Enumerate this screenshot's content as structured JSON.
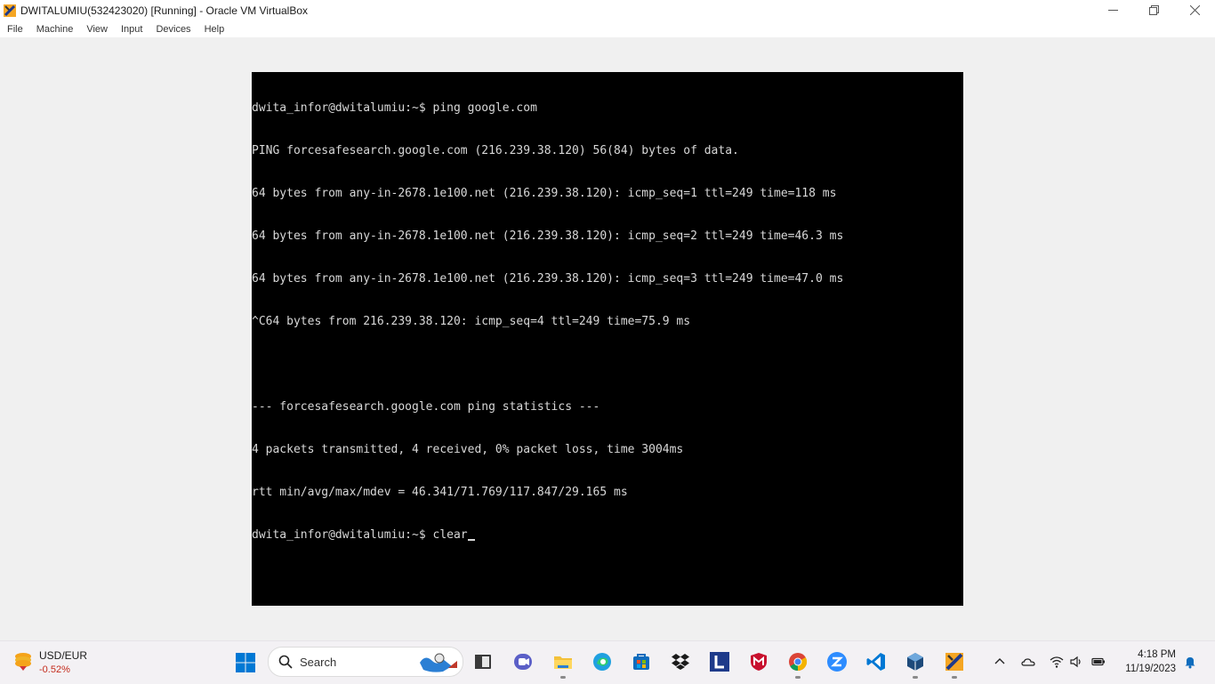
{
  "window": {
    "title": "DWITALUMIU(532423020) [Running] - Oracle VM VirtualBox"
  },
  "menu": {
    "items": [
      "File",
      "Machine",
      "View",
      "Input",
      "Devices",
      "Help"
    ]
  },
  "terminal": {
    "lines": [
      "dwita_infor@dwitalumiu:~$ ping google.com",
      "PING forcesafesearch.google.com (216.239.38.120) 56(84) bytes of data.",
      "64 bytes from any-in-2678.1e100.net (216.239.38.120): icmp_seq=1 ttl=249 time=118 ms",
      "64 bytes from any-in-2678.1e100.net (216.239.38.120): icmp_seq=2 ttl=249 time=46.3 ms",
      "64 bytes from any-in-2678.1e100.net (216.239.38.120): icmp_seq=3 ttl=249 time=47.0 ms",
      "^C64 bytes from 216.239.38.120: icmp_seq=4 ttl=249 time=75.9 ms",
      "",
      "--- forcesafesearch.google.com ping statistics ---",
      "4 packets transmitted, 4 received, 0% packet loss, time 3004ms",
      "rtt min/avg/max/mdev = 46.341/71.769/117.847/29.165 ms"
    ],
    "prompt_line": "dwita_infor@dwitalumiu:~$ clear"
  },
  "taskbar": {
    "widget": {
      "title": "USD/EUR",
      "change": "-0.52%"
    },
    "search_placeholder": "Search",
    "apps": [
      "start-icon",
      "file-manager-icon",
      "teams-icon",
      "file-explorer-icon",
      "edge-icon",
      "store-icon",
      "dropbox-icon",
      "l-app-icon",
      "mcafee-icon",
      "chrome-icon",
      "zoom-icon",
      "vscode-icon",
      "virtualbox-manager-icon",
      "virtualbox-vm-icon"
    ],
    "clock": {
      "time": "4:18 PM",
      "date": "11/19/2023"
    }
  },
  "colors": {
    "terminal_bg": "#000000",
    "terminal_fg": "#d8d8d8",
    "taskbar_bg": "#f3f1f4",
    "negative": "#c42b1c"
  }
}
